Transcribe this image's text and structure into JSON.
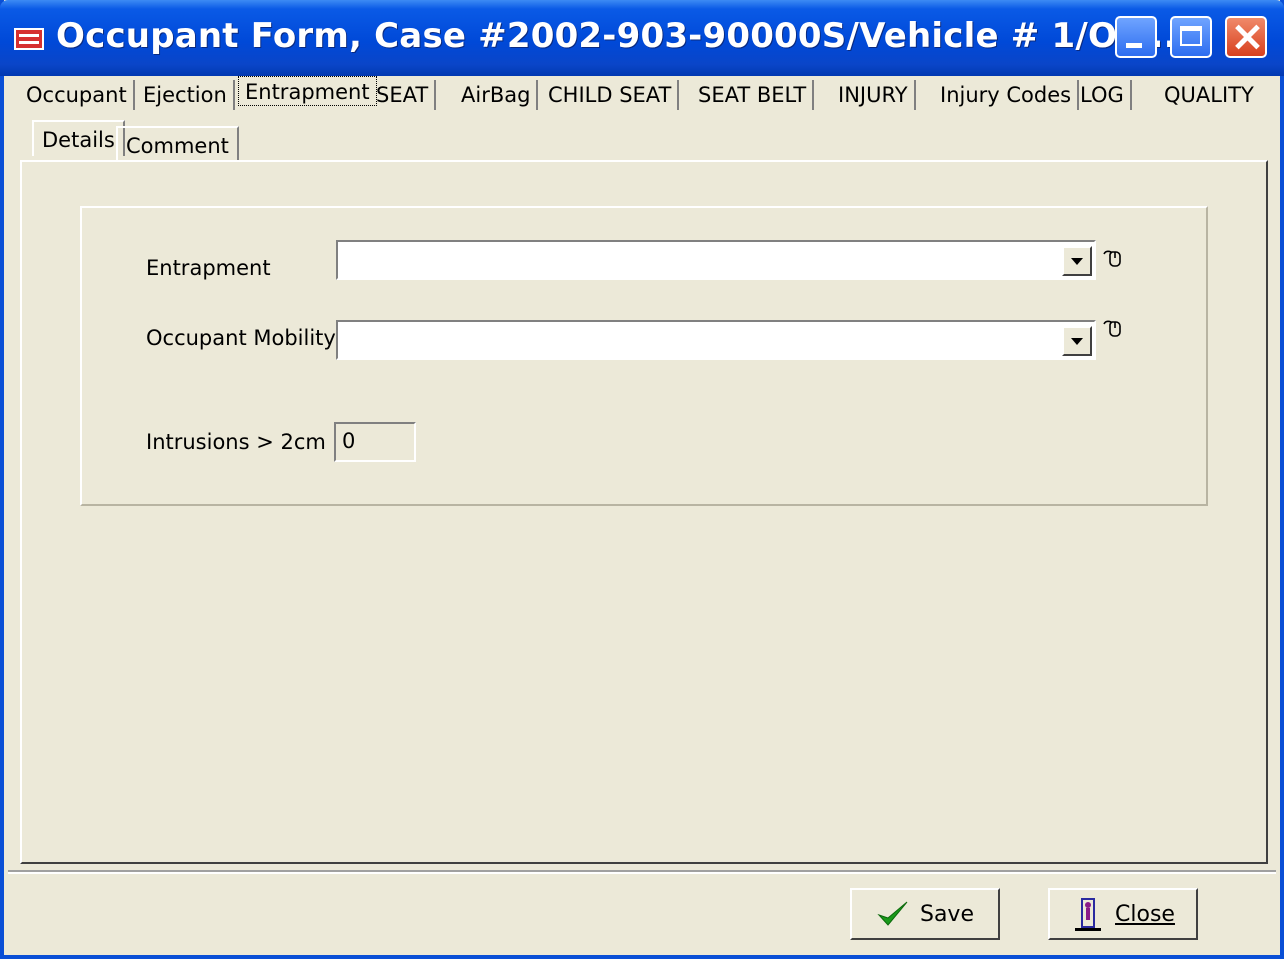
{
  "window": {
    "title": "Occupant Form, Case #2002-903-90000S/Vehicle # 1/Oc..."
  },
  "tabs": [
    {
      "label": "Occupant"
    },
    {
      "label": "Ejection"
    },
    {
      "label": "Entrapment",
      "active": true
    },
    {
      "label": "SEAT"
    },
    {
      "label": "AirBag"
    },
    {
      "label": "CHILD SEAT"
    },
    {
      "label": "SEAT BELT"
    },
    {
      "label": "INJURY"
    },
    {
      "label": "Injury Codes"
    },
    {
      "label": "LOG"
    },
    {
      "label": "QUALITY"
    }
  ],
  "subtabs": [
    {
      "label": "Details",
      "active": true
    },
    {
      "label": "Comment"
    }
  ],
  "form": {
    "entrapment": {
      "label": "Entrapment",
      "value": ""
    },
    "occupant_mobility": {
      "label": "Occupant Mobility",
      "value": ""
    },
    "intrusions": {
      "label": "Intrusions > 2cm",
      "value": "0"
    }
  },
  "buttons": {
    "save": "Save",
    "close": "Close"
  },
  "colors": {
    "titlebar": "#0049d8",
    "face": "#ece9d8",
    "save_check": "#1a9a1a",
    "close_icon": "#2a2aa0"
  }
}
